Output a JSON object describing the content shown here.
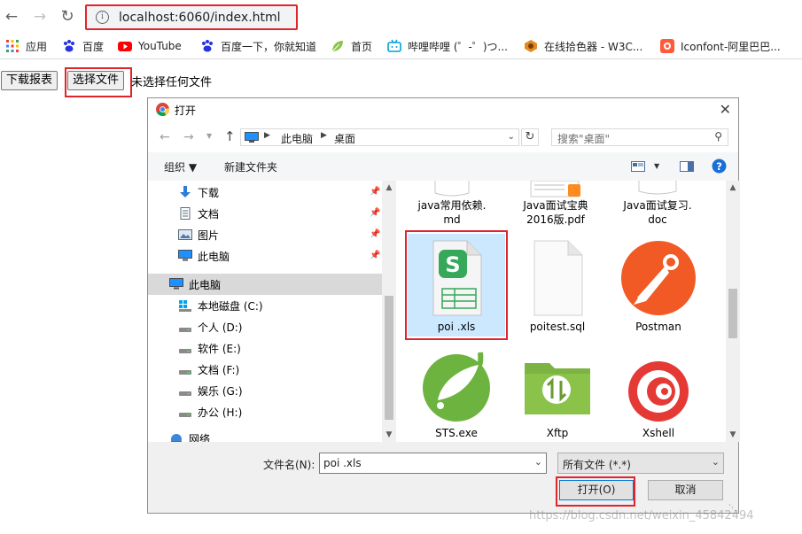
{
  "browser": {
    "url": "localhost:6060/index.html",
    "bookmarks": [
      {
        "label": "应用",
        "icon": "apps-grid-icon"
      },
      {
        "label": "百度",
        "icon": "baidu-paw-icon"
      },
      {
        "label": "YouTube",
        "icon": "youtube-icon"
      },
      {
        "label": "百度一下，你就知道",
        "icon": "baidu-paw-icon"
      },
      {
        "label": "首页",
        "icon": "leaf-icon"
      },
      {
        "label": "哔哩哔哩 (゜-゜)つ...",
        "icon": "bilibili-icon"
      },
      {
        "label": "在线拾色器 - W3C...",
        "icon": "color-picker-icon"
      },
      {
        "label": "Iconfont-阿里巴巴...",
        "icon": "iconfont-icon"
      }
    ]
  },
  "page": {
    "download_button": "下载报表",
    "choose_file_button": "选择文件",
    "no_file_text": "未选择任何文件"
  },
  "dialog": {
    "title": "打开",
    "breadcrumb": [
      "此电脑",
      "桌面"
    ],
    "search_placeholder": "搜索\"桌面\"",
    "organize": "组织 ▼",
    "new_folder": "新建文件夹",
    "nav": {
      "quick": [
        {
          "label": "下载",
          "icon": "download-arrow-icon"
        },
        {
          "label": "文档",
          "icon": "document-icon"
        },
        {
          "label": "图片",
          "icon": "pictures-icon"
        },
        {
          "label": "此电脑",
          "icon": "computer-icon"
        }
      ],
      "this_pc": "此电脑",
      "drives": [
        "本地磁盘 (C:)",
        "个人 (D:)",
        "软件 (E:)",
        "文档 (F:)",
        "娱乐 (G:)",
        "办公 (H:)"
      ],
      "network": "网络"
    },
    "files": [
      {
        "name": "java常用依赖.\nmd",
        "icon": "markdown-file-icon"
      },
      {
        "name": "Java面试宝典\n2016版.pdf",
        "icon": "pdf-file-icon"
      },
      {
        "name": "Java面试复习.\ndoc",
        "icon": "doc-file-icon"
      },
      {
        "name": "poi .xls",
        "icon": "spreadsheet-file-icon"
      },
      {
        "name": "poitest.sql",
        "icon": "sql-file-icon"
      },
      {
        "name": "Postman",
        "icon": "postman-icon"
      },
      {
        "name": "STS.exe",
        "icon": "spring-leaf-icon"
      },
      {
        "name": "Xftp",
        "icon": "xftp-folder-icon"
      },
      {
        "name": "Xshell",
        "icon": "xshell-icon"
      }
    ],
    "filename_label": "文件名(N):",
    "filename_value": "poi .xls",
    "filetype": "所有文件 (*.*)",
    "open_button": "打开(O)",
    "cancel_button": "取消"
  },
  "watermark": "https://blog.csdn.net/weixin_45842494",
  "colors": {
    "highlight_red": "#e0242a",
    "selection_bg": "#cce8ff"
  }
}
